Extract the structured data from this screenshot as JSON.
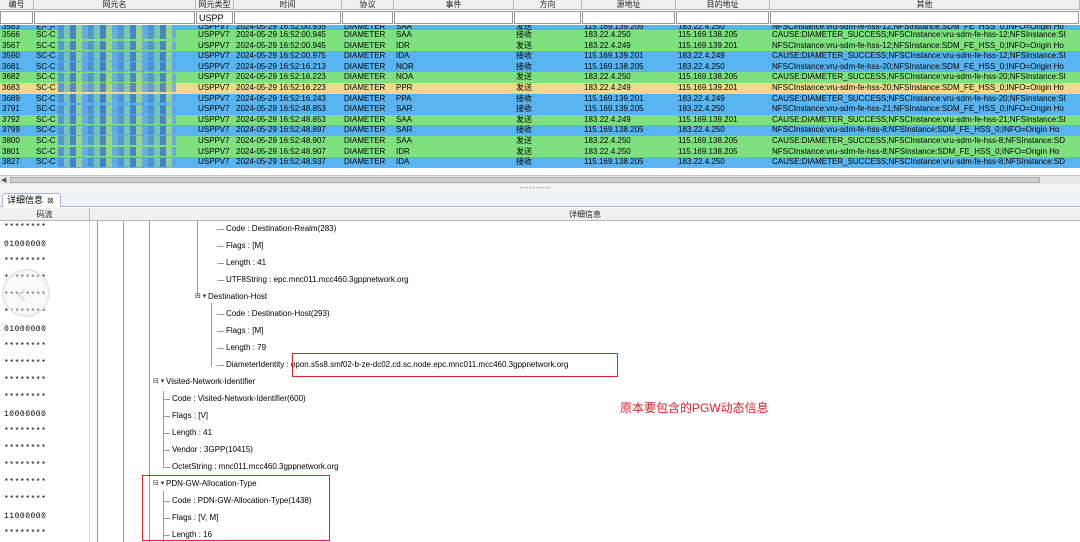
{
  "top_table": {
    "headers": [
      "编号",
      "网元名",
      "网元类型",
      "时间",
      "协议",
      "事件",
      "方向",
      "源地址",
      "目的地址",
      "其他"
    ],
    "filter": {
      "ne_type": "USPP"
    },
    "partial_row": {
      "id": "3563",
      "ne": "SC-C",
      "type": "USPPV7",
      "time": "2024-05-29 16:52:00.935",
      "proto": "DIAMETER",
      "event": "SAA",
      "dir": "发送",
      "src": "115.169.139.205",
      "dst": "183.22.4.250",
      "other": "NFSCInstance:vru-sdm-fe-hss-12;NFSInstance:SDM_FE_HSS_0;INFO=Origin Ho"
    },
    "rows": [
      {
        "id": "3566",
        "ne": "SC-C",
        "type": "USPPV7",
        "time": "2024-05-29 16:52:00.945",
        "proto": "DIAMETER",
        "event": "SAA",
        "dir": "接收",
        "src": "183.22.4.250",
        "dst": "115.169.138.205",
        "other": "CAUSE:DIAMETER_SUCCESS;NFSCInstance:vru-sdm-fe-hss-12;NFSInstance:SI",
        "color": "#7fe07f"
      },
      {
        "id": "3567",
        "ne": "SC-C",
        "type": "USPPV7",
        "time": "2024-05-29 16:52:00.945",
        "proto": "DIAMETER",
        "event": "IDR",
        "dir": "发送",
        "src": "183.22.4.249",
        "dst": "115.169.139.201",
        "other": "NFSCInstance:vru-sdm-fe-hss-12;NFSInstance:SDM_FE_HSS_0;INFO=Origin Ho",
        "color": "#7fe07f"
      },
      {
        "id": "3590",
        "ne": "SC-C",
        "type": "USPPV7",
        "time": "2024-05-29 16:52:00.975",
        "proto": "DIAMETER",
        "event": "IDA",
        "dir": "接收",
        "src": "115.169.139.201",
        "dst": "183.22.4.249",
        "other": "CAUSE:DIAMETER_SUCCESS;NFSCInstance:vru-sdm-fe-hss-12;NFSInstance:SI",
        "color": "#58b4f0"
      },
      {
        "id": "3681",
        "ne": "SC-C",
        "type": "USPPV7",
        "time": "2024-05-29 16:52:16.213",
        "proto": "DIAMETER",
        "event": "NOR",
        "dir": "接收",
        "src": "115.169.138.205",
        "dst": "183.22.4.250",
        "other": "NFSCInstance:vru-sdm-fe-hss-20;NFSInstance:SDM_FE_HSS_0;INFO=Origin Ho",
        "color": "#58b4f0"
      },
      {
        "id": "3682",
        "ne": "SC-C",
        "type": "USPPV7",
        "time": "2024-05-29 16:52:16.223",
        "proto": "DIAMETER",
        "event": "NOA",
        "dir": "发送",
        "src": "183.22.4.250",
        "dst": "115.169.138.205",
        "other": "CAUSE:DIAMETER_SUCCESS;NFSCInstance:vru-sdm-fe-hss-20;NFSInstance:SI",
        "color": "#7fe07f"
      },
      {
        "id": "3683",
        "ne": "SC-C",
        "type": "USPPV7",
        "time": "2024-05-29 16:52:16.223",
        "proto": "DIAMETER",
        "event": "PPR",
        "dir": "发送",
        "src": "183.22.4.249",
        "dst": "115.169.139.201",
        "other": "NFSCInstance:vru-sdm-fe-hss-20;NFSInstance:SDM_FE_HSS_0;INFO=Origin Ho",
        "color": "#f5d88a"
      },
      {
        "id": "3689",
        "ne": "SC-C",
        "type": "USPPV7",
        "time": "2024-05-29 16:52:16.243",
        "proto": "DIAMETER",
        "event": "PPA",
        "dir": "接收",
        "src": "115.169.139.201",
        "dst": "183.22.4.249",
        "other": "CAUSE:DIAMETER_SUCCESS;NFSCInstance:vru-sdm-fe-hss-20;NFSInstance:SI",
        "color": "#58b4f0"
      },
      {
        "id": "3791",
        "ne": "SC-C",
        "type": "USPPV7",
        "time": "2024-05-29 16:52:48.853",
        "proto": "DIAMETER",
        "event": "SAR",
        "dir": "接收",
        "src": "115.169.139.205",
        "dst": "183.22.4.250",
        "other": "NFSCInstance:vru-sdm-fe-hss-21;NFSInstance:SDM_FE_HSS_0;INFO=Origin Ho",
        "color": "#58b4f0"
      },
      {
        "id": "3792",
        "ne": "SC-C",
        "type": "USPPV7",
        "time": "2024-05-29 16:52:48.853",
        "proto": "DIAMETER",
        "event": "SAA",
        "dir": "发送",
        "src": "183.22.4.249",
        "dst": "115.169.139.201",
        "other": "CAUSE:DIAMETER_SUCCESS;NFSCInstance:vru-sdm-fe-hss-21;NFSInstance:SI",
        "color": "#7fe07f"
      },
      {
        "id": "3799",
        "ne": "SC-C",
        "type": "USPPV7",
        "time": "2024-05-29 16:52:48.897",
        "proto": "DIAMETER",
        "event": "SAR",
        "dir": "接收",
        "src": "115.169.138.205",
        "dst": "183.22.4.250",
        "other": "NFSCInstance:vru-sdm-fe-hss-8;NFSInstance:SDM_FE_HSS_0;INFO=Origin Ho",
        "color": "#58b4f0"
      },
      {
        "id": "3800",
        "ne": "SC-C",
        "type": "USPPV7",
        "time": "2024-05-29 16:52:48.907",
        "proto": "DIAMETER",
        "event": "SAA",
        "dir": "发送",
        "src": "183.22.4.250",
        "dst": "115.169.138.205",
        "other": "CAUSE:DIAMETER_SUCCESS;NFSCInstance:vru-sdm-fe-hss-8;NFSInstance:SD",
        "color": "#7fe07f"
      },
      {
        "id": "3801",
        "ne": "SC-C",
        "type": "USPPV7",
        "time": "2024-05-29 16:52:48.907",
        "proto": "DIAMETER",
        "event": "IDR",
        "dir": "发送",
        "src": "183.22.4.250",
        "dst": "115.169.138.205",
        "other": "NFSCInstance:vru-sdm-fe-hss-8;NFSInstance:SDM_FE_HSS_0;INFO=Origin Ho",
        "color": "#7fe07f"
      },
      {
        "id": "3827",
        "ne": "SC-C",
        "type": "USPPV7",
        "time": "2024-05-29 16:52:48.937",
        "proto": "DIAMETER",
        "event": "IDA",
        "dir": "接收",
        "src": "115.169.138.205",
        "dst": "183.22.4.250",
        "other": "CAUSE:DIAMETER_SUCCESS;NFSCInstance:vru-sdm-fe-hss-8;NFSInstance:SD",
        "color": "#58b4f0"
      }
    ]
  },
  "detail_panel": {
    "tab_label": "详细信息",
    "tab_close": "⊠",
    "col_code": "码流",
    "col_detail": "详细信息",
    "codes": [
      "********",
      "01000000",
      "********",
      "********",
      "********",
      "********",
      "01000000",
      "********",
      "********",
      "********",
      "********",
      "10000000",
      "********",
      "********",
      "********",
      "********",
      "********",
      "11000000",
      "********"
    ],
    "tree": [
      {
        "label": "Code : Destination-Realm(283)"
      },
      {
        "label": "Flags : [M]"
      },
      {
        "label": "Length : 41"
      },
      {
        "label": "UTF8String : epc.mnc011.mcc460.3gppnetwork.org"
      },
      {
        "label": "Destination-Host"
      },
      {
        "label": "Code : Destination-Host(293)"
      },
      {
        "label": "Flags : [M]"
      },
      {
        "label": "Length : 79"
      },
      {
        "label": "DiameterIdentity : ",
        "value": "opon.s5s8.smf02-b-ze-dc02.cd.sc.node.epc.mnc011.mcc460.3gppnetwork.org"
      },
      {
        "label": "Visited-Network-Identifier"
      },
      {
        "label": "Code : Visited-Network-Identifier(600)"
      },
      {
        "label": "Flags : [V]"
      },
      {
        "label": "Length : 41"
      },
      {
        "label": "Vendor : 3GPP(10415)"
      },
      {
        "label": "OctetString : mnc011.mcc460.3gppnetwork.org"
      },
      {
        "label": "PDN-GW-Allocation-Type"
      },
      {
        "label": "Code : PDN-GW-Allocation-Type(1438)"
      },
      {
        "label": "Flags : [V, M]"
      },
      {
        "label": "Length : 16"
      }
    ],
    "annotation": "原本要包含的PGW动态信息"
  }
}
